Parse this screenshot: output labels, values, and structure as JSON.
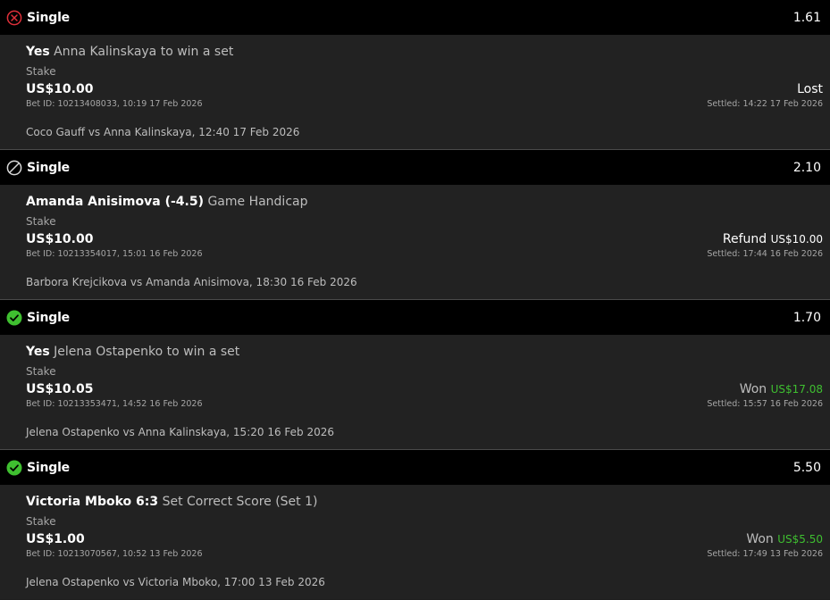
{
  "colors": {
    "header_bg": "#000000",
    "body_bg": "#222222",
    "won_green": "#3fbf30",
    "lost_red": "#e0303a",
    "muted_text": "#a6a6a6"
  },
  "bets": [
    {
      "status_icon": "lost-x-circle-icon",
      "type": "Single",
      "odds": "1.61",
      "pick": "Yes",
      "market": "Anna Kalinskaya to win a set",
      "stake_label": "Stake",
      "stake": "US$10.00",
      "bet_meta": "Bet ID: 10213408033, 10:19 17 Feb 2026",
      "event": "Coco Gauff vs Anna Kalinskaya, 12:40 17 Feb 2026",
      "result_label": "Lost",
      "result_amount": "",
      "settled": "Settled: 14:22 17 Feb 2026"
    },
    {
      "status_icon": "void-slash-circle-icon",
      "type": "Single",
      "odds": "2.10",
      "pick": "Amanda Anisimova (-4.5)",
      "market": "Game Handicap",
      "stake_label": "Stake",
      "stake": "US$10.00",
      "bet_meta": "Bet ID: 10213354017, 15:01 16 Feb 2026",
      "event": "Barbora Krejcikova vs Amanda Anisimova, 18:30 16 Feb 2026",
      "result_label": "Refund",
      "result_amount": "US$10.00",
      "settled": "Settled: 17:44 16 Feb 2026"
    },
    {
      "status_icon": "won-check-circle-icon",
      "type": "Single",
      "odds": "1.70",
      "pick": "Yes",
      "market": "Jelena Ostapenko to win a set",
      "stake_label": "Stake",
      "stake": "US$10.05",
      "bet_meta": "Bet ID: 10213353471, 14:52 16 Feb 2026",
      "event": "Jelena Ostapenko vs Anna Kalinskaya, 15:20 16 Feb 2026",
      "result_label": "Won",
      "result_amount": "US$17.08",
      "settled": "Settled: 15:57 16 Feb 2026"
    },
    {
      "status_icon": "won-check-circle-icon",
      "type": "Single",
      "odds": "5.50",
      "pick": "Victoria Mboko 6:3",
      "market": "Set Correct Score (Set 1)",
      "stake_label": "Stake",
      "stake": "US$1.00",
      "bet_meta": "Bet ID: 10213070567, 10:52 13 Feb 2026",
      "event": "Jelena Ostapenko vs Victoria Mboko, 17:00 13 Feb 2026",
      "result_label": "Won",
      "result_amount": "US$5.50",
      "settled": "Settled: 17:49 13 Feb 2026"
    }
  ]
}
